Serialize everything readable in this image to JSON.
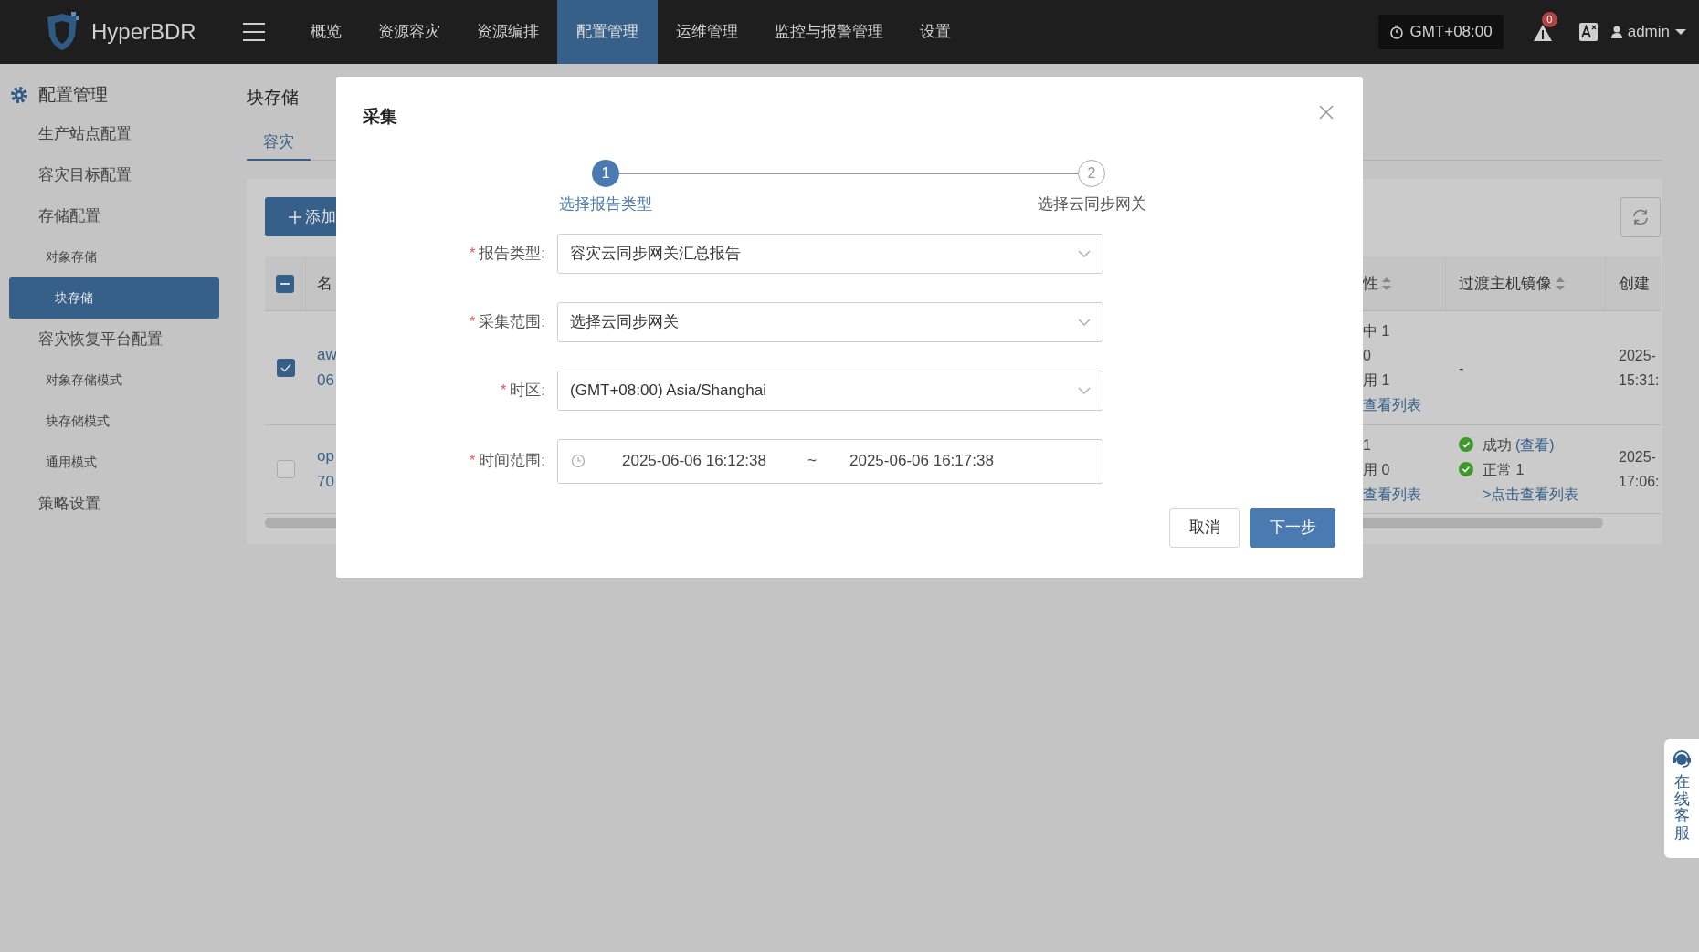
{
  "top_bar": {
    "logo": "HyperBDR",
    "nav": [
      {
        "label": "概览",
        "selected": false
      },
      {
        "label": "资源容灾",
        "selected": false
      },
      {
        "label": "资源编排",
        "selected": false
      },
      {
        "label": "配置管理",
        "selected": true
      },
      {
        "label": "运维管理",
        "selected": false
      },
      {
        "label": "监控与报警管理",
        "selected": false
      },
      {
        "label": "设置",
        "selected": false
      }
    ],
    "timezone": "GMT+08:00",
    "alert_count": "0",
    "user": "admin"
  },
  "sidebar": {
    "title": "配置管理",
    "items": [
      {
        "label": "生产站点配置",
        "selected": false
      },
      {
        "label": "容灾目标配置",
        "selected": false
      },
      {
        "label": "存储配置",
        "selected": false,
        "children": [
          {
            "label": "对象存储",
            "selected": false
          },
          {
            "label": "块存储",
            "selected": true
          }
        ]
      },
      {
        "label": "容灾恢复平台配置",
        "selected": false,
        "children": [
          {
            "label": "对象存储模式",
            "selected": false
          },
          {
            "label": "块存储模式",
            "selected": false
          },
          {
            "label": "通用模式",
            "selected": false
          }
        ]
      },
      {
        "label": "策略设置",
        "selected": false
      }
    ]
  },
  "page": {
    "title": "块存储",
    "tabs": [
      {
        "label": "容灾",
        "selected": true
      }
    ],
    "add_button": "添加",
    "table": {
      "select_all_indeterminate": true,
      "name_header": "名",
      "right_columns": [
        {
          "label": "性",
          "sortable": true
        },
        {
          "label": "过渡主机镜像",
          "sortable": true
        },
        {
          "label": "创建",
          "sortable": false
        }
      ],
      "rows": [
        {
          "checked": true,
          "name_lines": [
            "aw",
            "06"
          ],
          "attr_lines": [
            "中 1",
            "0",
            "用 1"
          ],
          "attr_link": "查看列表",
          "image": {
            "text": "-"
          },
          "created_lines": [
            "2025-",
            "15:31:"
          ]
        },
        {
          "checked": false,
          "name_lines": [
            "op",
            "70"
          ],
          "attr_lines": [
            "1",
            "用 0"
          ],
          "attr_link": "查看列表",
          "image": {
            "statuses": [
              {
                "text": "成功",
                "link": "(查看)",
                "ok": true
              },
              {
                "text": "正常 1",
                "ok": true
              }
            ],
            "link": ">点击查看列表"
          },
          "created_lines": [
            "2025-",
            "17:06:"
          ]
        }
      ]
    }
  },
  "modal": {
    "title": "采集",
    "steps": [
      {
        "number": "1",
        "label": "选择报告类型",
        "selected": true
      },
      {
        "number": "2",
        "label": "选择云同步网关",
        "selected": false
      }
    ],
    "fields": [
      {
        "kind": "select",
        "marker": "*",
        "label": "报告类型:",
        "value": "容灾云同步网关汇总报告"
      },
      {
        "kind": "select",
        "marker": "*",
        "label": "采集范围:",
        "value": "选择云同步网关"
      },
      {
        "kind": "select",
        "marker": "*",
        "label": "时区:",
        "value": "(GMT+08:00) Asia/Shanghai"
      },
      {
        "kind": "range",
        "marker": "*",
        "label": "时间范围:",
        "start": "2025-06-06 16:12:38",
        "separator": "~",
        "end": "2025-06-06 16:17:38"
      }
    ],
    "buttons": [
      {
        "label": "取消",
        "kind": "secondary"
      },
      {
        "label": "下一步",
        "kind": "primary"
      }
    ]
  },
  "support": {
    "label": "在线客服"
  }
}
